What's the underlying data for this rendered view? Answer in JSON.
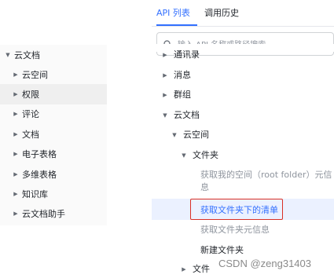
{
  "left_tree": {
    "items": [
      {
        "label": "云文档",
        "expanded": true
      },
      {
        "label": "云空间"
      },
      {
        "label": "权限"
      },
      {
        "label": "评论"
      },
      {
        "label": "文档"
      },
      {
        "label": "电子表格"
      },
      {
        "label": "多维表格"
      },
      {
        "label": "知识库"
      },
      {
        "label": "云文档助手"
      }
    ]
  },
  "right_panel": {
    "tabs": [
      {
        "label": "API 列表",
        "active": true
      },
      {
        "label": "调用历史",
        "active": false
      }
    ],
    "search": {
      "placeholder": "输入 API 名称或路径搜索"
    },
    "tree": {
      "items": [
        {
          "label": "通讯录"
        },
        {
          "label": "消息"
        },
        {
          "label": "群组"
        },
        {
          "label": "云文档",
          "expanded": true
        },
        {
          "label": "云空间",
          "expanded": true
        },
        {
          "label": "文件夹",
          "expanded": true
        },
        {
          "label_line1": "获取我的空间（root folder）元信",
          "label_line2": "息"
        },
        {
          "label": "获取文件夹下的清单",
          "selected": true
        },
        {
          "label": "获取文件夹元信息"
        },
        {
          "label": "新建文件夹"
        },
        {
          "label": "文件"
        }
      ]
    }
  },
  "watermark": "CSDN @zeng31403",
  "colors": {
    "accent": "#3370ff",
    "selected_bg": "#ebf1ff",
    "highlight_box": "#d93026",
    "left_selected_bg": "#efefef"
  }
}
